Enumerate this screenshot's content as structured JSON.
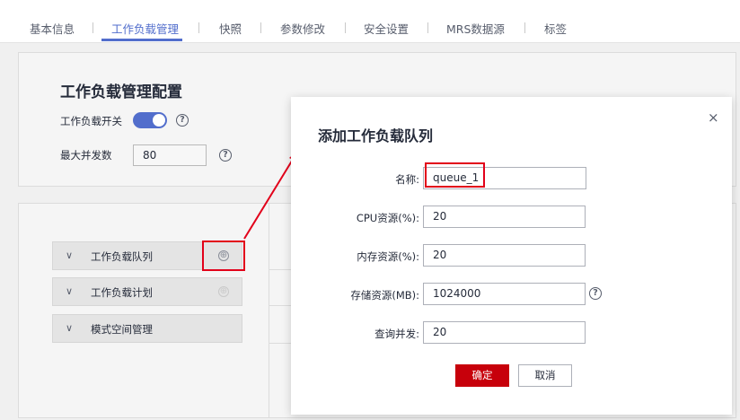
{
  "tabs": [
    {
      "label": "基本信息"
    },
    {
      "label": "工作负载管理",
      "active": true
    },
    {
      "label": "快照"
    },
    {
      "label": "参数修改"
    },
    {
      "label": "安全设置"
    },
    {
      "label": "MRS数据源"
    },
    {
      "label": "标签"
    }
  ],
  "config": {
    "title": "工作负载管理配置",
    "switch_label": "工作负载开关",
    "switch_on": true,
    "max_concurrency_label": "最大并发数",
    "max_concurrency_value": "80"
  },
  "tree": {
    "items": [
      {
        "label": "工作负载队列",
        "icon": "chevron-down-icon"
      },
      {
        "label": "工作负载计划",
        "icon": "chevron-down-icon"
      },
      {
        "label": "模式空间管理",
        "icon": "chevron-down-icon"
      }
    ],
    "add_icon_glyph": "⊕"
  },
  "dialog": {
    "title": "添加工作负载队列",
    "close_glyph": "×",
    "fields": [
      {
        "label": "名称:",
        "value": "queue_1"
      },
      {
        "label": "CPU资源(%):",
        "value": "20"
      },
      {
        "label": "内存资源(%):",
        "value": "20"
      },
      {
        "label": "存储资源(MB):",
        "value": "1024000"
      },
      {
        "label": "查询并发:",
        "value": "20"
      }
    ],
    "confirm_label": "确定",
    "cancel_label": "取消"
  },
  "icons": {
    "help_glyph": "?",
    "chevron_glyph": "∨"
  },
  "colors": {
    "accent": "#526ecc",
    "primary_button": "#c7000b",
    "annotation": "#e2001a"
  }
}
